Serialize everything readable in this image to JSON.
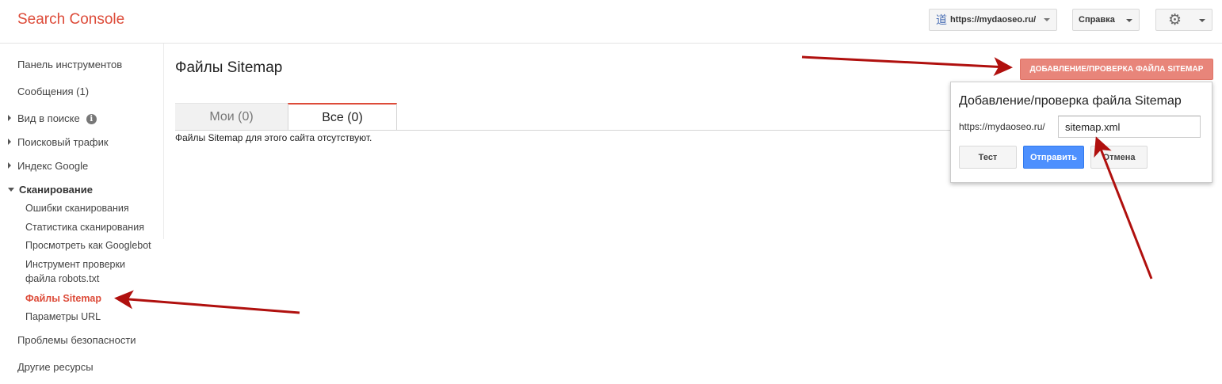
{
  "header": {
    "logo": "Search Console",
    "site_selector": {
      "favicon": "道",
      "label": "https://mydaoseo.ru/"
    },
    "help_label": "Справка",
    "settings_icon": "gear-icon"
  },
  "sidebar": {
    "items": [
      {
        "label": "Панель инструментов"
      },
      {
        "label": "Сообщения (1)"
      },
      {
        "label": "Вид в поиске"
      },
      {
        "label": "Поисковый трафик"
      },
      {
        "label": "Индекс Google"
      },
      {
        "label": "Сканирование"
      },
      {
        "label": "Ошибки сканирования"
      },
      {
        "label": "Статистика сканирования"
      },
      {
        "label": "Просмотреть как Googlebot"
      },
      {
        "label": "Инструмент проверки"
      },
      {
        "label": "файла robots.txt"
      },
      {
        "label": "Файлы Sitemap"
      },
      {
        "label": "Параметры URL"
      },
      {
        "label": "Проблемы безопасности"
      },
      {
        "label": "Другие ресурсы"
      }
    ]
  },
  "main": {
    "title": "Файлы Sitemap",
    "tabs": [
      {
        "label": "Мои (0)",
        "active": false
      },
      {
        "label": "Все (0)",
        "active": true
      }
    ],
    "empty_message": "Файлы Sitemap для этого сайта отсутствуют.",
    "add_button_label": "ДОБАВЛЕНИЕ/ПРОВЕРКА ФАЙЛА SITEMAP"
  },
  "popup": {
    "title": "Добавление/проверка файла Sitemap",
    "url_prefix": "https://mydaoseo.ru/",
    "input_value": "sitemap.xml",
    "buttons": {
      "test": "Тест",
      "submit": "Отправить",
      "cancel": "Отмена"
    }
  },
  "colors": {
    "brand_red": "#dd4b39",
    "primary_blue": "#4d90fe",
    "annotation_arrow": "#b0100e"
  }
}
